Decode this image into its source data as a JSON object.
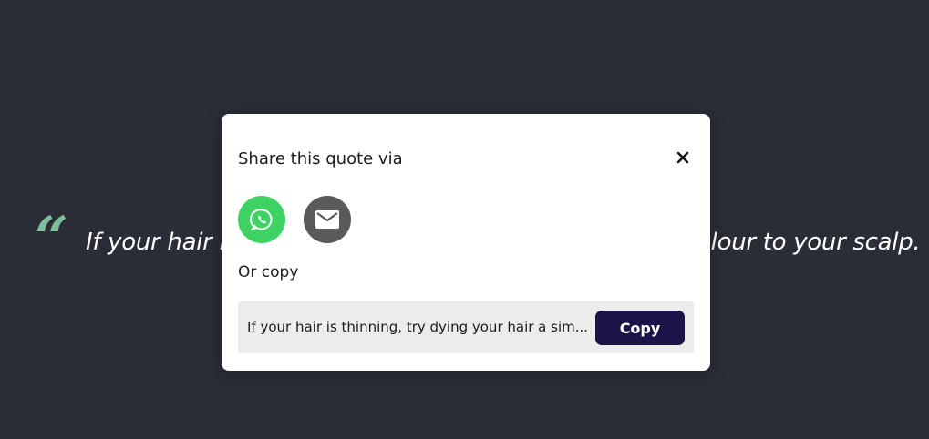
{
  "background": {
    "quote_mark": "“",
    "quote_text": "If your hair is thinning, try dying your hair a similar colour to your scalp.",
    "quote_color": "#7dbf9a",
    "background_color": "#2a2c36"
  },
  "modal": {
    "title": "Share this quote via",
    "close_icon": "close-icon",
    "share_options": [
      {
        "icon": "whatsapp-icon",
        "color": "#3ed163"
      },
      {
        "icon": "email-icon",
        "color": "#5a5a5a"
      }
    ],
    "or_copy_label": "Or copy",
    "copy_field_text": "If your hair is thinning, try dying your hair a sim...",
    "copy_button_label": "Copy",
    "copy_button_color": "#1b1448"
  }
}
